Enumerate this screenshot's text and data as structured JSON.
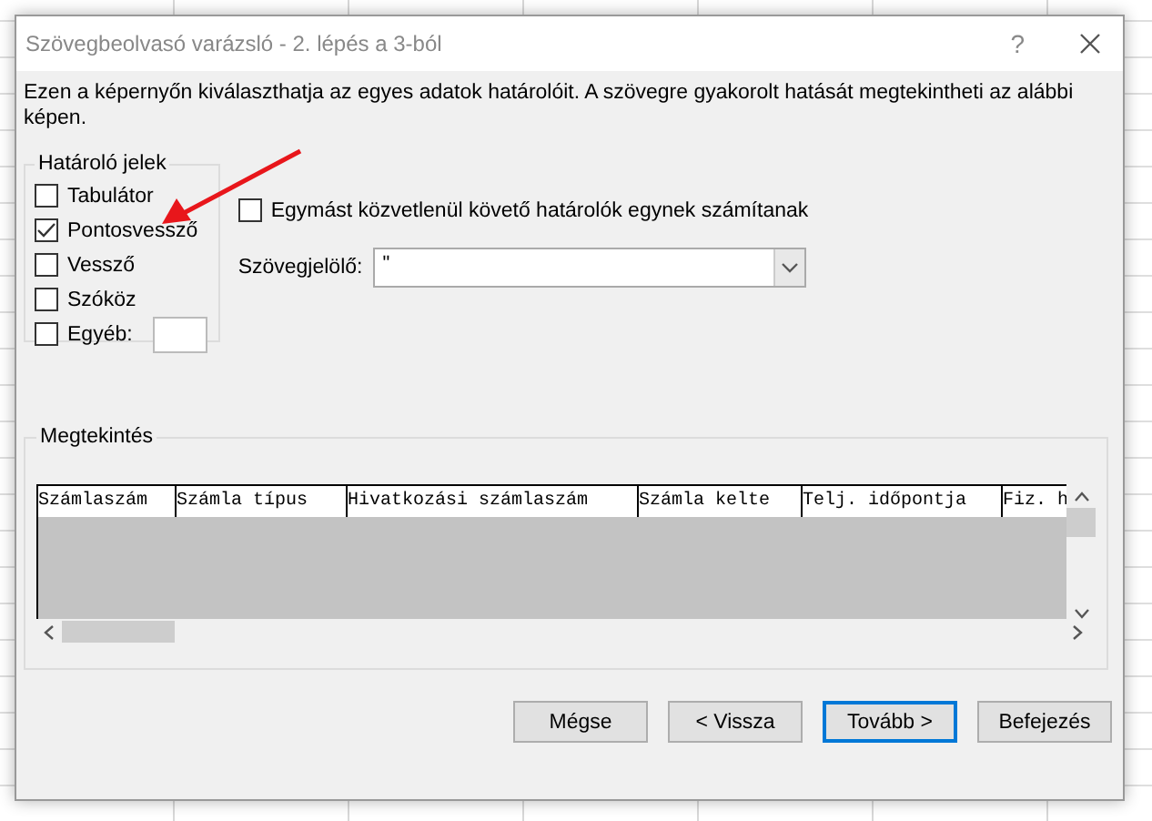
{
  "window": {
    "title": "Szövegbeolvasó varázsló - 2. lépés a 3-ból",
    "help": "?"
  },
  "description": "Ezen a képernyőn kiválaszthatja az egyes adatok határolóit. A szövegre gyakorolt hatását megtekintheti az alábbi képen.",
  "delimiters": {
    "title": "Határoló jelek",
    "items": [
      {
        "label": "Tabulátor",
        "checked": false
      },
      {
        "label": "Pontosvessző",
        "checked": true
      },
      {
        "label": "Vessző",
        "checked": false
      },
      {
        "label": "Szóköz",
        "checked": false
      },
      {
        "label": "Egyéb:",
        "checked": false,
        "kind": "other"
      }
    ]
  },
  "consecutive": {
    "label": "Egymást közvetlenül követő határolók egynek számítanak",
    "checked": false
  },
  "qualifier": {
    "label": "Szövegjelölő:",
    "value": "\""
  },
  "preview": {
    "title": "Megtekintés",
    "columns": [
      "Számlaszám",
      "Számla típus",
      "Hivatkozási számlaszám",
      "Számla kelte",
      "Telj. időpontja",
      "Fiz. h"
    ]
  },
  "buttons": [
    {
      "label": "Mégse",
      "focused": false
    },
    {
      "label": "< Vissza",
      "focused": false
    },
    {
      "label": "Tovább >",
      "focused": true
    },
    {
      "label": "Befejezés",
      "focused": false
    }
  ]
}
